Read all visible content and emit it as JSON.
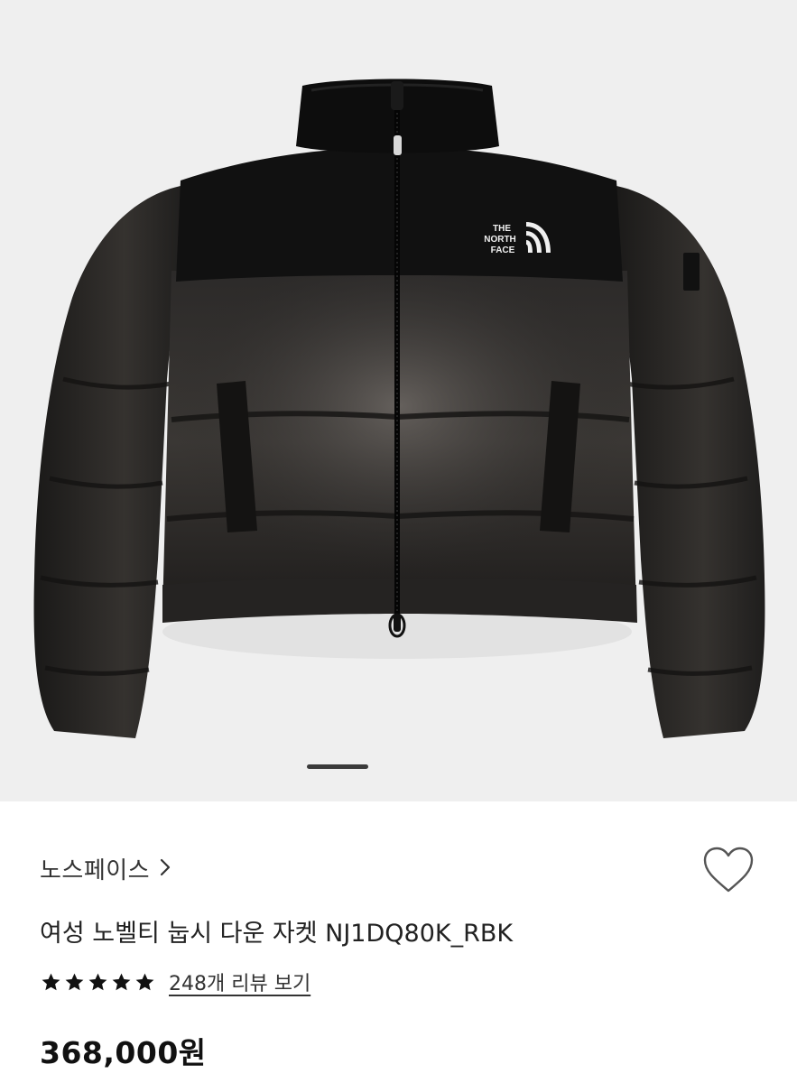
{
  "product": {
    "brand": "노스페이스",
    "name": "여성 노벨티 눕시 다운 자켓 NJ1DQ80K_RBK",
    "price": "368,000원",
    "rating_stars": 5,
    "review_link": "248개 리뷰 보기",
    "image": {
      "subject": "black cropped puffer down jacket",
      "logo_lines": [
        "THE",
        "NORTH",
        "FACE"
      ]
    }
  },
  "carousel": {
    "current_page": 1
  },
  "icons": {
    "brand_chevron": "chevron-right-icon",
    "like": "heart-outline-icon",
    "star": "star-filled-icon"
  },
  "colors": {
    "star": "#111111",
    "text_primary": "#222222",
    "image_background": "#efefef"
  }
}
